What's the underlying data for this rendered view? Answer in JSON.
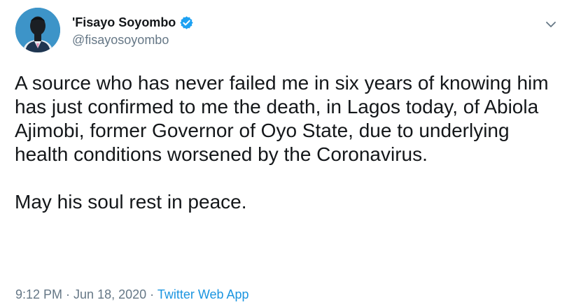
{
  "author": {
    "display_name": "'Fisayo Soyombo",
    "handle": "@fisayosoyombo",
    "verified": true,
    "avatar_icon": "person-silhouette-avatar"
  },
  "tweet": {
    "paragraphs": [
      "A source who has never failed me in six years of knowing him has just confirmed to me the death, in Lagos today, of Abiola Ajimobi, former Governor of Oyo State, due to underlying health conditions worsened by the Coronavirus.",
      "May his soul rest in peace."
    ]
  },
  "meta": {
    "time": "9:12 PM",
    "separator": " · ",
    "date": "Jun 18, 2020",
    "source": "Twitter Web App"
  },
  "colors": {
    "text": "#14171a",
    "secondary": "#657786",
    "link": "#1b95e0",
    "verified_badge": "#1da1f2",
    "avatar_background": "#3d94c8"
  },
  "icons": {
    "verified": "verified-badge-icon",
    "menu": "chevron-down-icon"
  }
}
